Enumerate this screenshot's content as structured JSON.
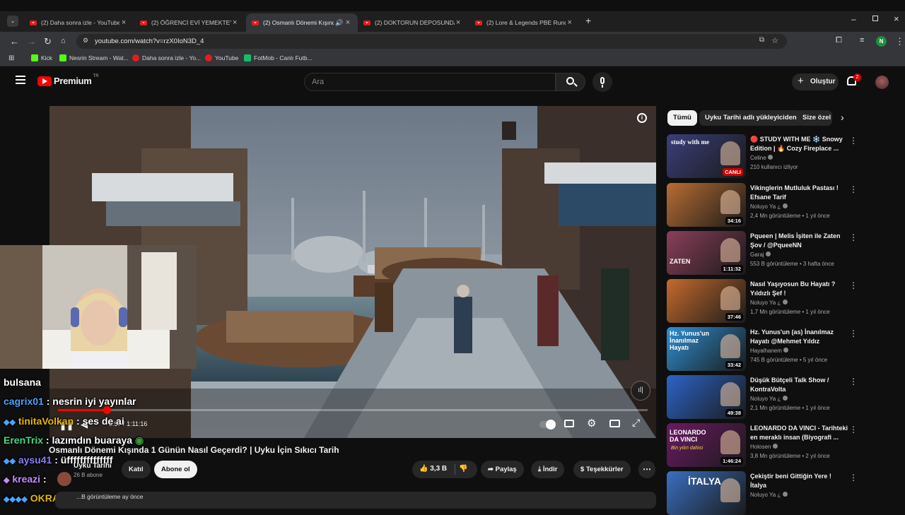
{
  "browser": {
    "tabs": [
      {
        "label": "(2) Daha sonra izle - YouTube",
        "active": false
      },
      {
        "label": "(2) ÖĞRENCİ EVİ YEMEKTEYİZ M...",
        "active": false
      },
      {
        "label": "(2) Osmanlı Dönemi Kışında...",
        "active": true
      },
      {
        "label": "(2) DOKTORUN DEPOSUNDA KO...",
        "active": false
      },
      {
        "label": "(2) Lore & Legends PBE Rundo...",
        "active": false
      }
    ],
    "new_tab": "+",
    "url": "youtube.com/watch?v=rzX0IoN3D_4",
    "profile_initial": "N",
    "bookmarks": [
      {
        "label": "Kick",
        "color": "#53fc18"
      },
      {
        "label": "Nesrin Stream - Wat...",
        "color": "#53fc18"
      },
      {
        "label": "Daha sonra izle - Yo...",
        "color": "#e31d1d"
      },
      {
        "label": "YouTube",
        "color": "#e31d1d"
      },
      {
        "label": "FotMob - Canlı Futb...",
        "color": "#10c06b"
      }
    ]
  },
  "youtube": {
    "logo_text": "Premium",
    "logo_suffix": "TR",
    "search_placeholder": "Ara",
    "create_label": "Oluştur",
    "notification_count": "2"
  },
  "video": {
    "current_time": "5:57",
    "sep": "/",
    "duration": "1:11:16",
    "title": "Osmanlı Dönemi Kışında 1 Günün Nasıl Geçerdi? | Uyku İçin Sıkıcı Tarih",
    "channel": "Uyku Tarihi",
    "subscribers": "26 B abone",
    "join_label": "Katıl",
    "subscribe_label": "Abone ol",
    "likes": "3,3 B",
    "share_label": "Paylaş",
    "download_label": "İndir",
    "thanks_label": "Teşekkürler",
    "desc_preview": "...B görüntüleme  ay önce"
  },
  "chat": [
    {
      "user": "",
      "message": "bulsana",
      "color": "#ffffff"
    },
    {
      "user": "cagrix01",
      "message": ": nesrin iyi yayınlar",
      "color": "#4aa3ff"
    },
    {
      "user": "tinitaVolkan",
      "message": ": ses de ai",
      "color": "#e6b800"
    },
    {
      "user": "ErenTrix",
      "message": ": lazımdın buaraya",
      "color": "#3ddc84"
    },
    {
      "user": "aysu41",
      "message": ": üffffffffffffff",
      "color": "#8a7dff"
    },
    {
      "user": "kreazi",
      "message": ":",
      "color": "#c38bff"
    },
    {
      "user": "OKRAUL",
      "message": ":",
      "color": "#e6b800"
    }
  ],
  "chips": [
    "Tümü",
    "Uyku Tarihi adlı yükleyiciden",
    "Size özel"
  ],
  "recommendations": [
    {
      "title": "🔴 STUDY WITH ME ❄️ Snowy Edition | 🔥 Cozy Fireplace ...",
      "channel": "Celine",
      "meta": "210 kullanıcı izliyor",
      "duration": "CANLI",
      "thumb": "#3a3f7a"
    },
    {
      "title": "Vikinglerin Mutluluk Pastası ! Efsane Tarif",
      "channel": "Noluyo Ya ¿",
      "meta": "2,4 Mn görüntüleme • 1 yıl önce",
      "duration": "34:16",
      "thumb": "#b86d34"
    },
    {
      "title": "Pqueen | Melis İşiten ile Zaten Şov / @PqueeNN",
      "channel": "Garaj",
      "meta": "553 B görüntüleme • 3 hafta önce",
      "duration": "1:11:32",
      "thumb": "#8a3f5a"
    },
    {
      "title": "Nasıl Yaşıyosun Bu Hayatı ? Yıldızlı Şef !",
      "channel": "Noluyo Ya ¿",
      "meta": "1,7 Mn görüntüleme • 1 yıl önce",
      "duration": "37:46",
      "thumb": "#c56a2e"
    },
    {
      "title": "Hz. Yunus'un (as) İnanılmaz Hayatı @Mehmet Yıldız",
      "channel": "Hayalhanem",
      "meta": "745 B görüntüleme • 5 yıl önce",
      "duration": "33:42",
      "thumb": "#2f8fd1"
    },
    {
      "title": "Düşük Bütçeli Talk Show / KontraVolta",
      "channel": "Noluyo Ya ¿",
      "meta": "2,1 Mn görüntüleme • 1 yıl önce",
      "duration": "49:38",
      "thumb": "#2c64c8"
    },
    {
      "title": "LEONARDO DA VINCI - Tarihteki en meraklı insan (Biyografi ...",
      "channel": "Holosen",
      "meta": "3,8 Mn görüntüleme • 2 yıl önce",
      "duration": "1:46:24",
      "thumb": "#6b1a63"
    },
    {
      "title": "Çekiştir beni Gittiğin Yere ! İtalya",
      "channel": "Noluyo Ya ¿",
      "meta": "",
      "duration": "",
      "thumb": "#3a6fc0"
    }
  ],
  "thumb_texts": {
    "leonardo": "LEONARDO DA VINCI",
    "leonardo_sub": "Bin yılın dahisi",
    "yunus": "Hz. Yunus'un İnanılmaz Hayatı",
    "zaten": "ZATEN",
    "italya": "İTALYA",
    "study": "study with me"
  },
  "progress_fraction": 0.083
}
